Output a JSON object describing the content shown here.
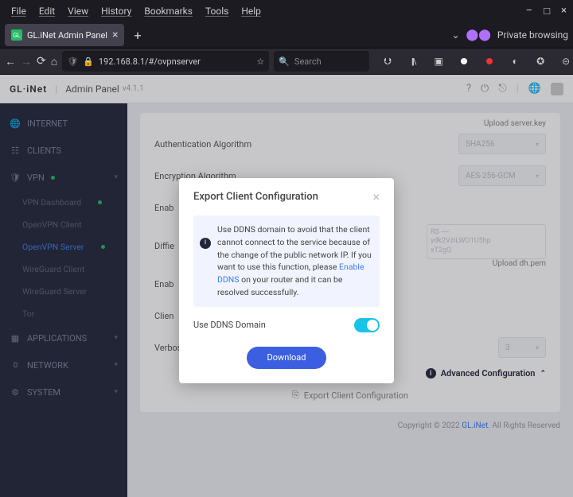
{
  "os_menu": {
    "file": "File",
    "edit": "Edit",
    "view": "View",
    "history": "History",
    "bookmarks": "Bookmarks",
    "tools": "Tools",
    "help": "Help"
  },
  "window_controls": {
    "min": "–",
    "max": "□",
    "close": "×"
  },
  "browser": {
    "tab_title": "GL.iNet Admin Panel",
    "private_label": "Private browsing",
    "url": "192.168.8.1/#/ovpnserver",
    "search_placeholder": "Search"
  },
  "admin": {
    "brand": "GL·iNet",
    "panel_label": "Admin Panel",
    "version": "v4.1.1"
  },
  "sidebar": {
    "internet": "INTERNET",
    "clients": "CLIENTS",
    "vpn": "VPN",
    "vpn_sub": {
      "dashboard": "VPN Dashboard",
      "ovpn_client": "OpenVPN Client",
      "ovpn_server": "OpenVPN Server",
      "wg_client": "WireGuard Client",
      "wg_server": "WireGuard Server",
      "tor": "Tor"
    },
    "applications": "APPLICATIONS",
    "network": "NETWORK",
    "system": "SYSTEM"
  },
  "form": {
    "upload_server_key": "Upload server.key",
    "auth_alg_label": "Authentication Algorithm",
    "auth_alg_value": "SHA256",
    "enc_alg_label": "Encryption Algorithm",
    "enc_alg_value": "AES-256-GCM",
    "enable_tls": "Enab",
    "dh_label": "Diffie",
    "dh_hint": "RS ----\nydk2VziLWO1U5hp\nxT2gQ",
    "upload_dh": "Upload dh.pem",
    "enable_something": "Enab",
    "client_label": "Clien",
    "verbosity_label": "Verbosity Level",
    "verbosity_value": "3",
    "adv_conf": "Advanced Configuration",
    "export_link": "Export Client Configuration"
  },
  "footer": {
    "copyright_pre": "Copyright © 2022 ",
    "brand_link": "GL.iNet",
    "copyright_post": ". All Rights Reserved"
  },
  "modal": {
    "title": "Export Client Configuration",
    "info_text_a": "Use DDNS domain to avoid that the client cannot connect to the service because of the change of the public network IP. If you want to use this function, please ",
    "info_link": "Enable DDNS",
    "info_text_b": " on your router and it can be resolved successfully.",
    "ddns_label": "Use DDNS Domain",
    "download": "Download"
  }
}
